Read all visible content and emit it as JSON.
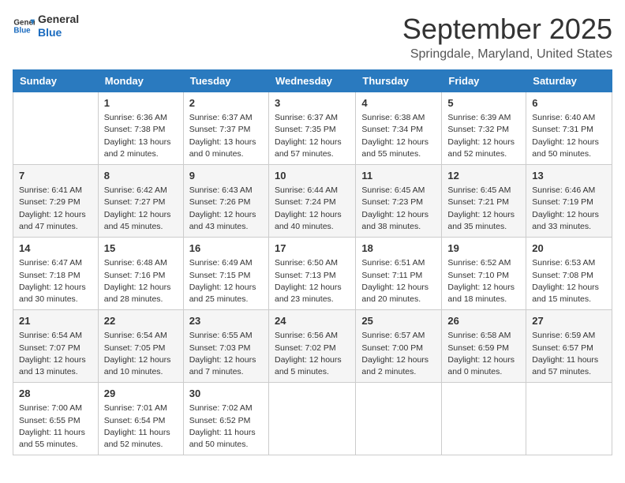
{
  "logo": {
    "line1": "General",
    "line2": "Blue"
  },
  "title": "September 2025",
  "location": "Springdale, Maryland, United States",
  "weekdays": [
    "Sunday",
    "Monday",
    "Tuesday",
    "Wednesday",
    "Thursday",
    "Friday",
    "Saturday"
  ],
  "weeks": [
    [
      {
        "day": "",
        "info": ""
      },
      {
        "day": "1",
        "info": "Sunrise: 6:36 AM\nSunset: 7:38 PM\nDaylight: 13 hours\nand 2 minutes."
      },
      {
        "day": "2",
        "info": "Sunrise: 6:37 AM\nSunset: 7:37 PM\nDaylight: 13 hours\nand 0 minutes."
      },
      {
        "day": "3",
        "info": "Sunrise: 6:37 AM\nSunset: 7:35 PM\nDaylight: 12 hours\nand 57 minutes."
      },
      {
        "day": "4",
        "info": "Sunrise: 6:38 AM\nSunset: 7:34 PM\nDaylight: 12 hours\nand 55 minutes."
      },
      {
        "day": "5",
        "info": "Sunrise: 6:39 AM\nSunset: 7:32 PM\nDaylight: 12 hours\nand 52 minutes."
      },
      {
        "day": "6",
        "info": "Sunrise: 6:40 AM\nSunset: 7:31 PM\nDaylight: 12 hours\nand 50 minutes."
      }
    ],
    [
      {
        "day": "7",
        "info": "Sunrise: 6:41 AM\nSunset: 7:29 PM\nDaylight: 12 hours\nand 47 minutes."
      },
      {
        "day": "8",
        "info": "Sunrise: 6:42 AM\nSunset: 7:27 PM\nDaylight: 12 hours\nand 45 minutes."
      },
      {
        "day": "9",
        "info": "Sunrise: 6:43 AM\nSunset: 7:26 PM\nDaylight: 12 hours\nand 43 minutes."
      },
      {
        "day": "10",
        "info": "Sunrise: 6:44 AM\nSunset: 7:24 PM\nDaylight: 12 hours\nand 40 minutes."
      },
      {
        "day": "11",
        "info": "Sunrise: 6:45 AM\nSunset: 7:23 PM\nDaylight: 12 hours\nand 38 minutes."
      },
      {
        "day": "12",
        "info": "Sunrise: 6:45 AM\nSunset: 7:21 PM\nDaylight: 12 hours\nand 35 minutes."
      },
      {
        "day": "13",
        "info": "Sunrise: 6:46 AM\nSunset: 7:19 PM\nDaylight: 12 hours\nand 33 minutes."
      }
    ],
    [
      {
        "day": "14",
        "info": "Sunrise: 6:47 AM\nSunset: 7:18 PM\nDaylight: 12 hours\nand 30 minutes."
      },
      {
        "day": "15",
        "info": "Sunrise: 6:48 AM\nSunset: 7:16 PM\nDaylight: 12 hours\nand 28 minutes."
      },
      {
        "day": "16",
        "info": "Sunrise: 6:49 AM\nSunset: 7:15 PM\nDaylight: 12 hours\nand 25 minutes."
      },
      {
        "day": "17",
        "info": "Sunrise: 6:50 AM\nSunset: 7:13 PM\nDaylight: 12 hours\nand 23 minutes."
      },
      {
        "day": "18",
        "info": "Sunrise: 6:51 AM\nSunset: 7:11 PM\nDaylight: 12 hours\nand 20 minutes."
      },
      {
        "day": "19",
        "info": "Sunrise: 6:52 AM\nSunset: 7:10 PM\nDaylight: 12 hours\nand 18 minutes."
      },
      {
        "day": "20",
        "info": "Sunrise: 6:53 AM\nSunset: 7:08 PM\nDaylight: 12 hours\nand 15 minutes."
      }
    ],
    [
      {
        "day": "21",
        "info": "Sunrise: 6:54 AM\nSunset: 7:07 PM\nDaylight: 12 hours\nand 13 minutes."
      },
      {
        "day": "22",
        "info": "Sunrise: 6:54 AM\nSunset: 7:05 PM\nDaylight: 12 hours\nand 10 minutes."
      },
      {
        "day": "23",
        "info": "Sunrise: 6:55 AM\nSunset: 7:03 PM\nDaylight: 12 hours\nand 7 minutes."
      },
      {
        "day": "24",
        "info": "Sunrise: 6:56 AM\nSunset: 7:02 PM\nDaylight: 12 hours\nand 5 minutes."
      },
      {
        "day": "25",
        "info": "Sunrise: 6:57 AM\nSunset: 7:00 PM\nDaylight: 12 hours\nand 2 minutes."
      },
      {
        "day": "26",
        "info": "Sunrise: 6:58 AM\nSunset: 6:59 PM\nDaylight: 12 hours\nand 0 minutes."
      },
      {
        "day": "27",
        "info": "Sunrise: 6:59 AM\nSunset: 6:57 PM\nDaylight: 11 hours\nand 57 minutes."
      }
    ],
    [
      {
        "day": "28",
        "info": "Sunrise: 7:00 AM\nSunset: 6:55 PM\nDaylight: 11 hours\nand 55 minutes."
      },
      {
        "day": "29",
        "info": "Sunrise: 7:01 AM\nSunset: 6:54 PM\nDaylight: 11 hours\nand 52 minutes."
      },
      {
        "day": "30",
        "info": "Sunrise: 7:02 AM\nSunset: 6:52 PM\nDaylight: 11 hours\nand 50 minutes."
      },
      {
        "day": "",
        "info": ""
      },
      {
        "day": "",
        "info": ""
      },
      {
        "day": "",
        "info": ""
      },
      {
        "day": "",
        "info": ""
      }
    ]
  ]
}
